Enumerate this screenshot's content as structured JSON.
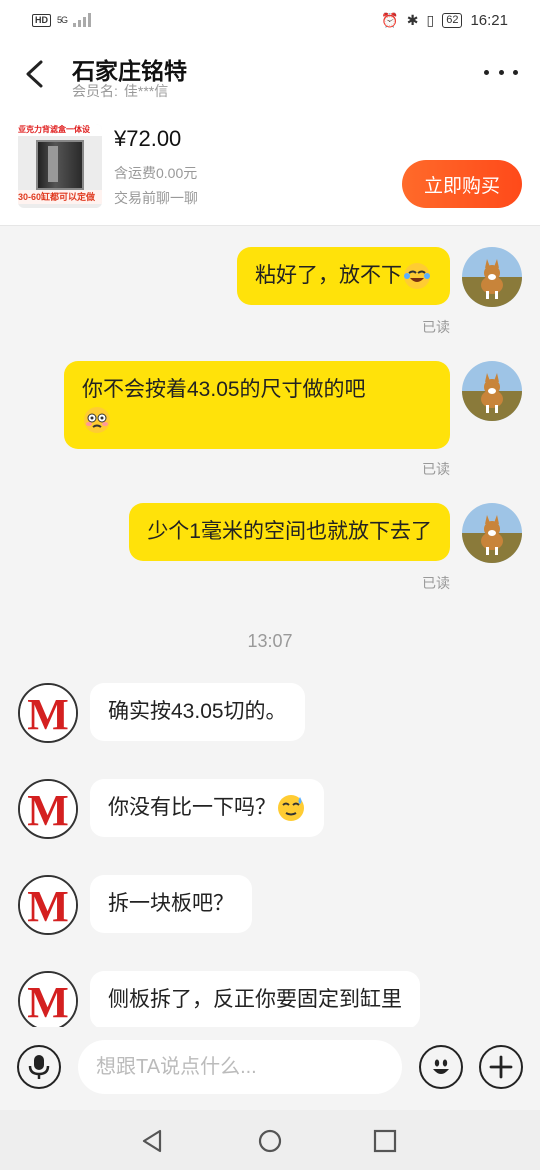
{
  "status_bar": {
    "hd": "HD",
    "signal": "5G",
    "battery": "62",
    "time": "16:21"
  },
  "header": {
    "shop_name": "石家庄铭特",
    "member_label": "会员名:",
    "member_name": "佳***信"
  },
  "product": {
    "thumb_top_text": "亚克力背滤盒一体设",
    "thumb_bottom_text": "30-60缸都可以定做",
    "price": "¥72.00",
    "shipping": "含运费0.00元",
    "chat_before": "交易前聊一聊",
    "buy_label": "立即购买"
  },
  "messages": {
    "m1": {
      "text": "粘好了，放不下",
      "status": "已读"
    },
    "m2": {
      "line1": "你不会按着43.05的尺寸做的吧",
      "status": "已读"
    },
    "m3": {
      "text": "少个1毫米的空间也就放下去了",
      "status": "已读"
    },
    "timestamp": "13:07",
    "m4": {
      "text": "确实按43.05切的。"
    },
    "m5": {
      "text": "你没有比一下吗？"
    },
    "m6": {
      "text": "拆一块板吧？"
    },
    "m7": {
      "text": "侧板拆了，反正你要固定到缸里"
    }
  },
  "input": {
    "placeholder": "想跟TA说点什么..."
  },
  "colors": {
    "outgoing_bubble": "#ffe20a",
    "buy_button": "#ff5a22",
    "avatar_m": "#d42020"
  },
  "icons": [
    "back-arrow-icon",
    "more-icon",
    "microphone-icon",
    "smiley-icon",
    "plus-icon",
    "nav-back-icon",
    "nav-home-icon",
    "nav-recent-icon"
  ]
}
